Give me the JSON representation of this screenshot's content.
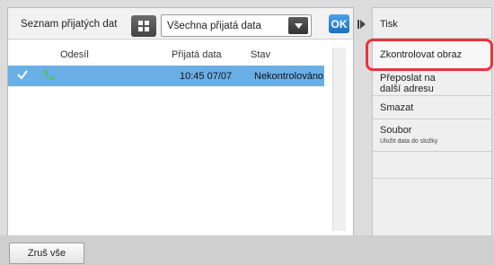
{
  "header": {
    "title": "Seznam přijatých dat",
    "filter_value": "Všechna přijatá data",
    "ok_label": "OK"
  },
  "table": {
    "columns": [
      "Odesíl",
      "Přijatá data",
      "Stav"
    ],
    "rows": [
      {
        "time": "10:45 07/07",
        "status": "Nekontrolováno",
        "selected": true
      }
    ]
  },
  "actions": {
    "print": "Tisk",
    "check_image": "Zkontrolovat obraz",
    "forward_line1": "Přeposlat na",
    "forward_line2": "další adresu",
    "delete": "Smazat",
    "file": "Soubor",
    "file_sub": "Uložit data do složky"
  },
  "footer": {
    "cancel_all": "Zruš vše"
  },
  "colors": {
    "selected_row": "#6aaee6",
    "highlight": "#e8353f",
    "ok": "#1a6fc0"
  }
}
